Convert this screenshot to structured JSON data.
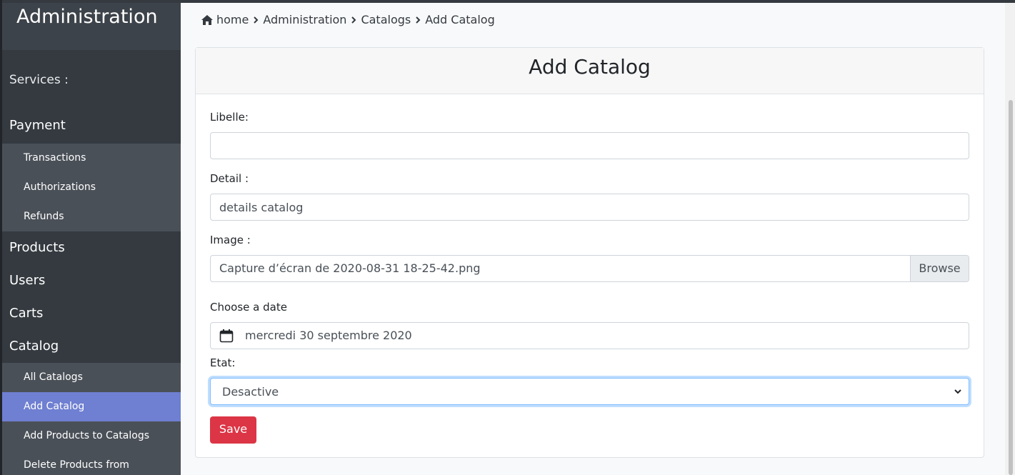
{
  "sidebar": {
    "brand": "Administration",
    "services_label": "Services :",
    "payment": {
      "label": "Payment",
      "items": [
        "Transactions",
        "Authorizations",
        "Refunds"
      ]
    },
    "products": "Products",
    "users": "Users",
    "carts": "Carts",
    "catalog": {
      "label": "Catalog",
      "items": [
        "All Catalogs",
        "Add Catalog",
        "Add Products to Catalogs",
        "Delete Products from"
      ]
    }
  },
  "breadcrumb": {
    "home": "home",
    "administration": "Administration",
    "catalogs": "Catalogs",
    "current": "Add Catalog",
    "separator": ">"
  },
  "form": {
    "title": "Add Catalog",
    "libelle_label": "Libelle:",
    "libelle_value": "",
    "detail_label": "Detail :",
    "detail_value": "details catalog",
    "image_label": "Image :",
    "image_value": "Capture d’écran de 2020-08-31 18-25-42.png",
    "browse_label": "Browse",
    "date_label": "Choose a date",
    "date_value": "mercredi 30 septembre 2020",
    "etat_label": "Etat:",
    "etat_value": "Desactive",
    "save_label": "Save"
  },
  "colors": {
    "sidebar_bg": "#343a40",
    "active_item": "#6f7fd1",
    "save_button": "#dc3545"
  },
  "icons": [
    "home-icon",
    "chevron-right-icon",
    "calendar-icon",
    "chevron-down-icon"
  ]
}
